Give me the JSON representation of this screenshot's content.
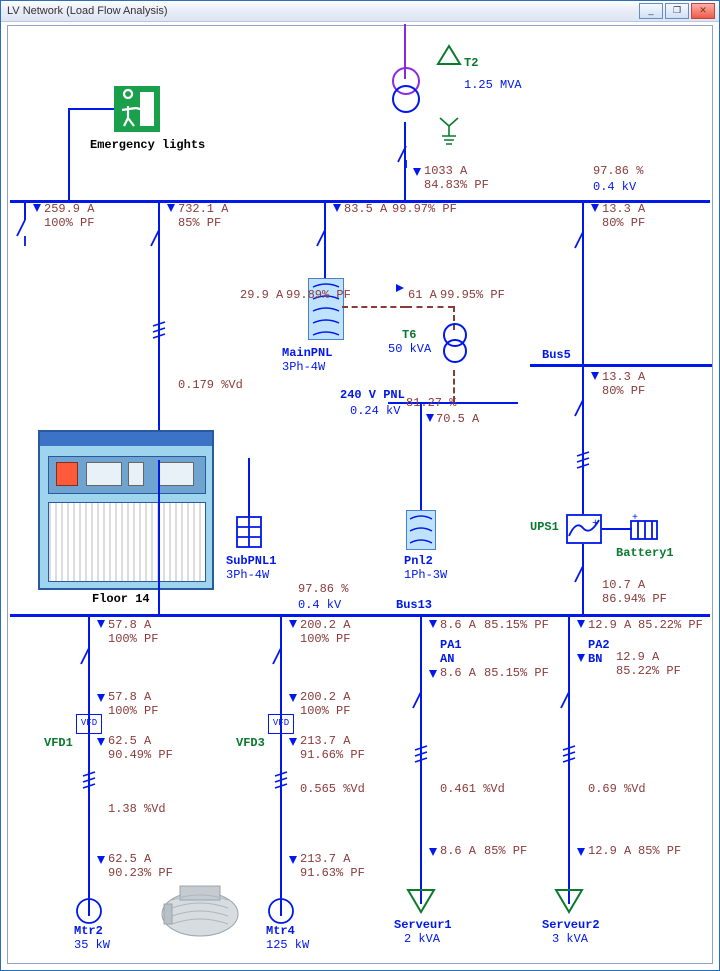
{
  "window_title": "LV Network (Load Flow Analysis)",
  "emergency_lights": "Emergency lights",
  "floor14": "Floor 14",
  "top": {
    "t2_name": "T2",
    "t2_rating": "1.25 MVA",
    "main_a": "1033 A",
    "main_pf": "84.83% PF",
    "bus_pct": "97.86 %",
    "bus_kv": "0.4 kV"
  },
  "bus1": {
    "f1_a": "259.9 A",
    "f1_pf": "100% PF",
    "f2_a": "732.1 A",
    "f2_pf": "85% PF",
    "f3_a": "83.5 A",
    "f3_pf": "99.97% PF",
    "f4_a": "13.3 A",
    "f4_pf": "80% PF"
  },
  "mainpnl": {
    "name": "MainPNL",
    "cfg": "3Ph-4W",
    "a": "29.9 A",
    "pf": "99.89% PF"
  },
  "t6": {
    "name": "T6",
    "rating": "50 kVA",
    "a": "61 A",
    "pf": "99.95% PF"
  },
  "pnl240": {
    "name": "240 V PNL",
    "kv": "0.24 kV",
    "pct": "81.27 %",
    "a": "70.5 A"
  },
  "subpnl1": {
    "name": "SubPNL1",
    "cfg": "3Ph-4W",
    "vd": "0.179 %Vd"
  },
  "pnl2": {
    "name": "Pnl2",
    "cfg": "1Ph-3W"
  },
  "bus5_name": "Bus5",
  "bus5_f": {
    "a": "13.3 A",
    "pf": "80% PF"
  },
  "ups1": "UPS1",
  "battery1": "Battery1",
  "bus13": {
    "name": "Bus13",
    "pct": "97.86 %",
    "kv": "0.4 kV",
    "ups_a": "10.7 A",
    "ups_pf": "86.94% PF",
    "f1_a": "57.8 A",
    "f1_pf": "100% PF",
    "f2_a": "200.2 A",
    "f2_pf": "100% PF",
    "f3_a": "8.6 A",
    "f3_pf": "85.15% PF",
    "f4_a": "12.9 A",
    "f4_pf": "85.22% PF"
  },
  "pa1": {
    "name": "PA1",
    "ph": "AN",
    "a": "8.6 A",
    "pf": "85.15% PF"
  },
  "pa2": {
    "name": "PA2",
    "ph": "BN",
    "a": "12.9 A",
    "pf": "85.22% PF"
  },
  "vfd1": {
    "name": "VFD1",
    "in_a": "57.8 A",
    "in_pf": "100% PF",
    "out_a": "62.5 A",
    "out_pf": "90.49% PF"
  },
  "vfd3": {
    "name": "VFD3",
    "in_a": "200.2 A",
    "in_pf": "100% PF",
    "out_a": "213.7 A",
    "out_pf": "91.66% PF"
  },
  "mtr2": {
    "name": "Mtr2",
    "rating": "35 kW",
    "vd": "1.38 %Vd",
    "a": "62.5 A",
    "pf": "90.23% PF"
  },
  "mtr4": {
    "name": "Mtr4",
    "rating": "125 kW",
    "vd": "0.565 %Vd",
    "a": "213.7 A",
    "pf": "91.63% PF"
  },
  "srv1": {
    "name": "Serveur1",
    "rating": "2 kVA",
    "vd": "0.461 %Vd",
    "a": "8.6 A",
    "pf": "85% PF"
  },
  "srv2": {
    "name": "Serveur2",
    "rating": "3 kVA",
    "vd": "0.69 %Vd",
    "a": "12.9 A",
    "pf": "85% PF"
  }
}
